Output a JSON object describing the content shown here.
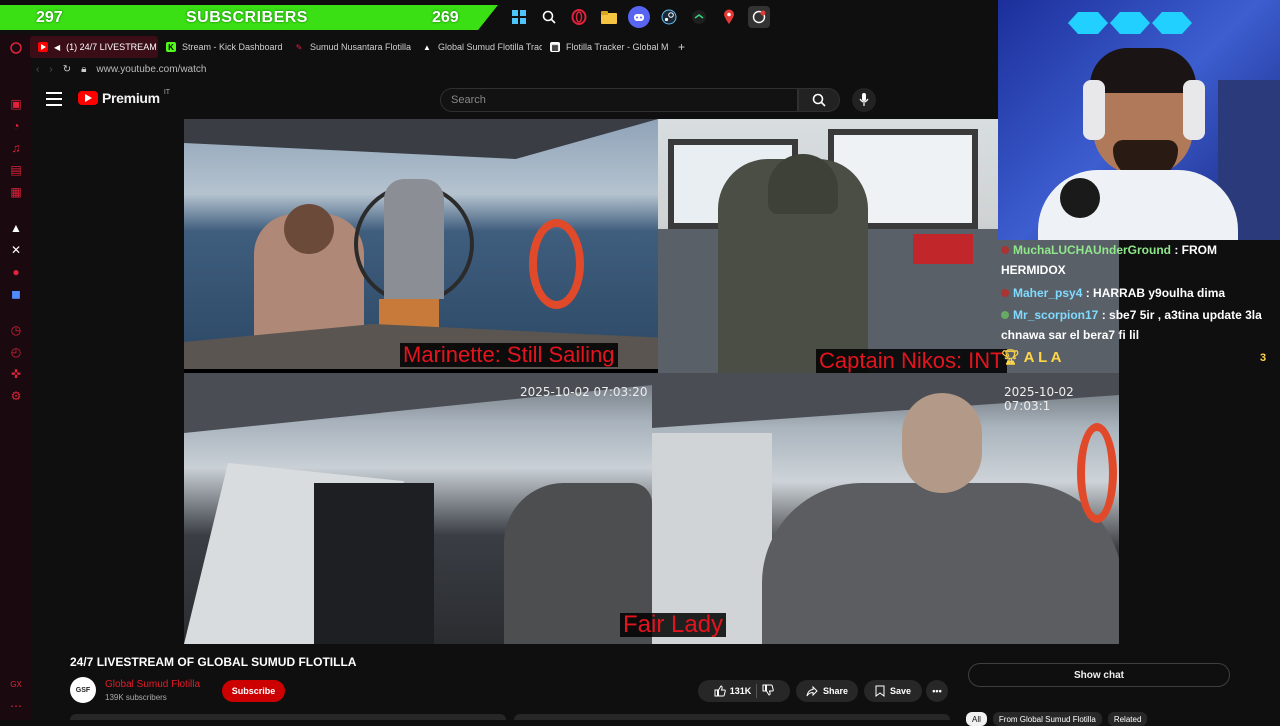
{
  "stream_overlay": {
    "subscriber_count_left": "297",
    "subscribers_label": "SUBSCRIBERS",
    "subscriber_count_right": "269",
    "bar_color": "#3adf14"
  },
  "taskbar": {
    "icons": [
      "windows-icon",
      "search-icon",
      "opera-gx-icon",
      "folder-icon",
      "discord-icon",
      "steam-icon",
      "app-icon",
      "maps-pin-icon",
      "recorder-icon"
    ]
  },
  "browser": {
    "tabs": [
      {
        "label": "(1) 24/7 LIVESTREAM",
        "icon": "youtube-icon",
        "active": true
      },
      {
        "label": "Stream - Kick Dashboard",
        "icon": "kick-icon",
        "active": false
      },
      {
        "label": "Sumud Nusantara Flotilla",
        "icon": "feather-icon",
        "active": false
      },
      {
        "label": "Global Sumud Flotilla Trac",
        "icon": "triangle-icon",
        "active": false
      },
      {
        "label": "Flotilla Tracker - Global M",
        "icon": "page-icon",
        "active": false
      }
    ],
    "new_tab": "+",
    "url": "www.youtube.com/watch",
    "accent": "#e0223b"
  },
  "youtube": {
    "brand": "Premium",
    "country": "IT",
    "search_placeholder": "Search"
  },
  "video": {
    "captions": {
      "top_left": "Marinette: Still Sailing",
      "top_right": "Captain Nikos: INT",
      "bottom_center": "Fair Lady"
    },
    "timestamps": {
      "bottom_left": "2025-10-02 07:03:20",
      "bottom_right": "2025-10-02 07:03:1"
    }
  },
  "chat": {
    "messages": [
      {
        "user": "MuchaLUCHAUnderGround",
        "sep": " : ",
        "text": "FROM",
        "cont": "HERMIDOX"
      },
      {
        "user": "Maher_psy4",
        "sep": " : ",
        "text": "HARRAB y9oulha dima"
      },
      {
        "user": "Mr_scorpion17",
        "sep": " : ",
        "text": "sbe7 5ir , a3tina update 3la",
        "cont": "chnawa sar el bera7 fi lil"
      }
    ],
    "top_user": "A L A",
    "count": "3"
  },
  "info": {
    "title": "24/7 LIVESTREAM OF GLOBAL SUMUD FLOTILLA",
    "channel": "Global Sumud Flotilla",
    "subscribers": "139K subscribers",
    "subscribe": "Subscribe",
    "likes": "131K",
    "share": "Share",
    "save": "Save",
    "show_chat": "Show chat",
    "chips": [
      "All",
      "From Global Sumud Flotilla",
      "Related"
    ]
  }
}
